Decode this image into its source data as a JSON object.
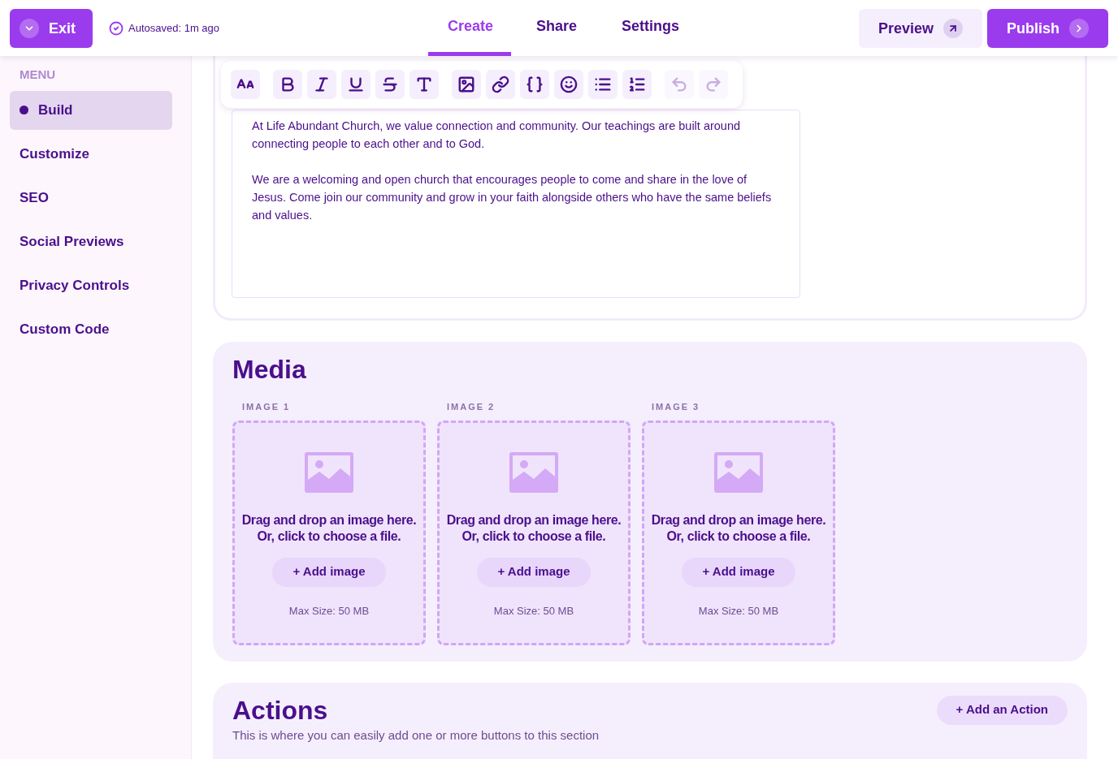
{
  "header": {
    "exit": "Exit",
    "autosave": "Autosaved: 1m ago",
    "tabs": [
      {
        "label": "Create",
        "selected": true
      },
      {
        "label": "Share",
        "selected": false
      },
      {
        "label": "Settings",
        "selected": false
      }
    ],
    "preview": "Preview",
    "publish": "Publish"
  },
  "sidebar": {
    "heading": "MENU",
    "items": [
      {
        "label": "Build",
        "selected": true
      },
      {
        "label": "Customize",
        "selected": false
      },
      {
        "label": "SEO",
        "selected": false
      },
      {
        "label": "Social Previews",
        "selected": false
      },
      {
        "label": "Privacy Controls",
        "selected": false
      },
      {
        "label": "Custom Code",
        "selected": false
      }
    ]
  },
  "toolbar": [
    {
      "kind": "text-size",
      "disabled": false
    },
    {
      "kind": "bold",
      "disabled": false
    },
    {
      "kind": "italic",
      "disabled": false
    },
    {
      "kind": "underline",
      "disabled": false
    },
    {
      "kind": "strikethrough",
      "disabled": false
    },
    {
      "kind": "font",
      "disabled": false
    },
    {
      "kind": "image",
      "disabled": false
    },
    {
      "kind": "link",
      "disabled": false
    },
    {
      "kind": "variable",
      "disabled": false
    },
    {
      "kind": "emoji",
      "disabled": false
    },
    {
      "kind": "bullet-list",
      "disabled": false
    },
    {
      "kind": "numbered-list",
      "disabled": false
    },
    {
      "kind": "undo",
      "disabled": true
    },
    {
      "kind": "redo",
      "disabled": true
    }
  ],
  "editor": {
    "paragraphs": [
      "At Life Abundant Church, we value connection and community. Our teachings are built around connecting people to each other and to God.",
      "We are a welcoming and open church that encourages people to come and share in the love of Jesus. Come join our community and grow in your faith alongside others who have the same beliefs and values."
    ]
  },
  "media": {
    "title": "Media",
    "images": [
      {
        "label": "IMAGE 1",
        "prompt": "Drag and drop an image here. Or, click to choose a file.",
        "button": "+ Add image",
        "limit": "Max Size: 50 MB"
      },
      {
        "label": "IMAGE 2",
        "prompt": "Drag and drop an image here. Or, click to choose a file.",
        "button": "+ Add image",
        "limit": "Max Size: 50 MB"
      },
      {
        "label": "IMAGE 3",
        "prompt": "Drag and drop an image here. Or, click to choose a file.",
        "button": "+ Add image",
        "limit": "Max Size: 50 MB"
      }
    ]
  },
  "actions": {
    "title": "Actions",
    "description": "This is where you can easily add one or more buttons to this section",
    "button": "+ Add an Action"
  }
}
